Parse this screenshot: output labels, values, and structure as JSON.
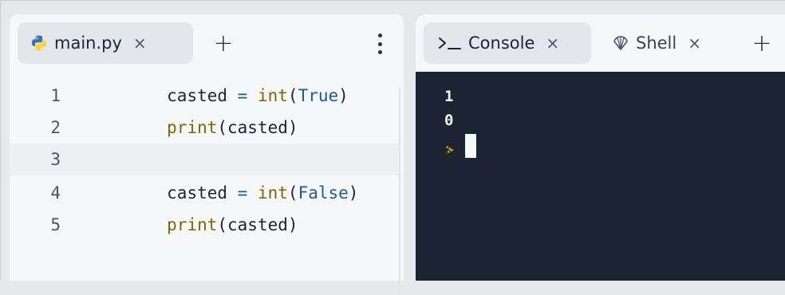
{
  "editor": {
    "tab": {
      "label": "main.py",
      "close": "×",
      "icon": "python-icon"
    },
    "add_tab": "+",
    "lines": [
      {
        "number": "1",
        "tokens": [
          {
            "text": "casted ",
            "kind": "plain"
          },
          {
            "text": "=",
            "kind": "op"
          },
          {
            "text": " ",
            "kind": "plain"
          },
          {
            "text": "int",
            "kind": "fn"
          },
          {
            "text": "(",
            "kind": "plain"
          },
          {
            "text": "True",
            "kind": "const"
          },
          {
            "text": ")",
            "kind": "plain"
          }
        ]
      },
      {
        "number": "2",
        "tokens": [
          {
            "text": "print",
            "kind": "fn"
          },
          {
            "text": "(casted)",
            "kind": "plain"
          }
        ]
      },
      {
        "number": "3",
        "tokens": []
      },
      {
        "number": "4",
        "tokens": [
          {
            "text": "casted ",
            "kind": "plain"
          },
          {
            "text": "=",
            "kind": "op"
          },
          {
            "text": " ",
            "kind": "plain"
          },
          {
            "text": "int",
            "kind": "fn"
          },
          {
            "text": "(",
            "kind": "plain"
          },
          {
            "text": "False",
            "kind": "const"
          },
          {
            "text": ")",
            "kind": "plain"
          }
        ]
      },
      {
        "number": "5",
        "tokens": [
          {
            "text": "print",
            "kind": "fn"
          },
          {
            "text": "(casted)",
            "kind": "plain"
          }
        ]
      }
    ],
    "highlighted_line": "3"
  },
  "console": {
    "tabs": [
      {
        "label": "Console",
        "close": "×",
        "icon": "terminal-icon",
        "active": true
      },
      {
        "label": "Shell",
        "close": "×",
        "icon": "shell-icon",
        "active": false
      }
    ],
    "add_tab": "+",
    "output": [
      "1",
      "0"
    ]
  },
  "colors": {
    "editor_bg": "#f6f7f9",
    "console_bg": "#1c2333",
    "keyword_fn": "#806500",
    "constant": "#1a5b9c",
    "prompt": "#e0a800",
    "python_blue": "#3776ab",
    "python_yellow": "#ffd43b"
  }
}
